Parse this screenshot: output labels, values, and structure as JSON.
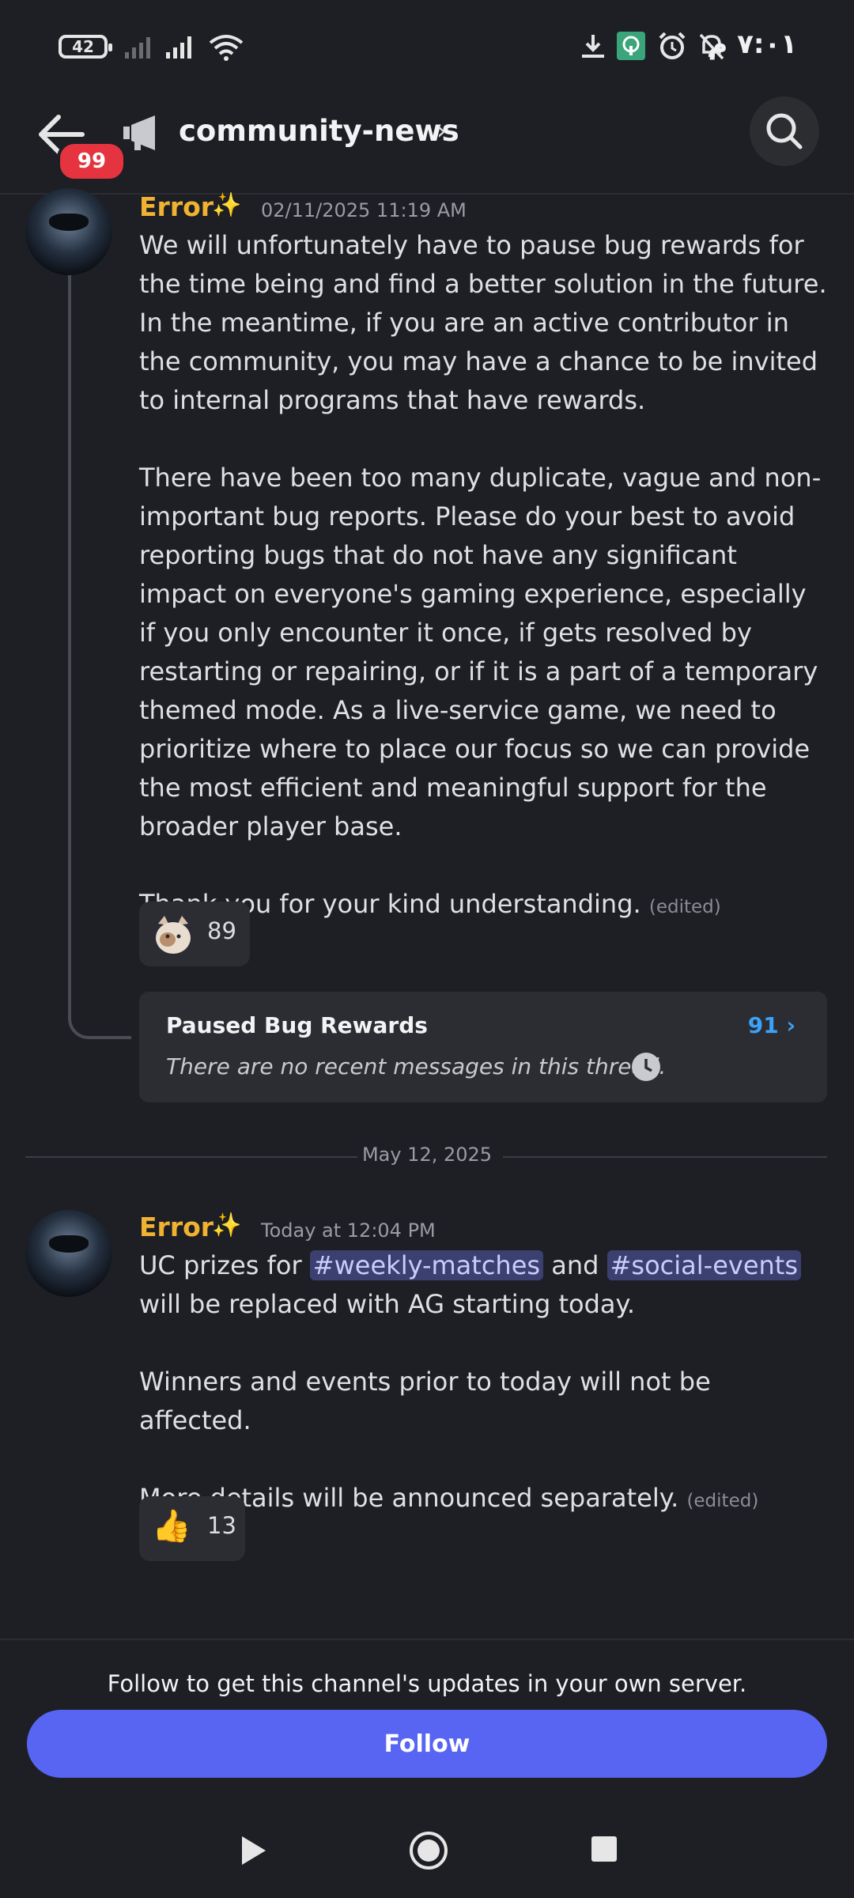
{
  "status_bar": {
    "battery": "42",
    "time": "٧:٠١ م"
  },
  "header": {
    "unread_badge": "99",
    "channel_name": "community-news",
    "chevron": "›"
  },
  "messages": [
    {
      "author": "Error",
      "timestamp": "02/11/2025 11:19 AM",
      "paragraphs": [
        "We will unfortunately have to pause bug rewards for the time being and find a better solution in the future. In the meantime, if you are an active contributor in the community, you may have a chance to be invited to internal programs that have rewards.",
        "There have been too many duplicate, vague and non-important bug reports. Please do your best to avoid reporting bugs that do not have any significant impact on everyone's gaming experience, especially if you only encounter it once, if gets resolved by restarting or repairing, or if it is a part of a temporary themed mode. As a live-service game, we need to prioritize where to place our focus so we can provide the most efficient and meaningful support for the broader player base.",
        "Thank you for your kind understanding."
      ],
      "edited": "(edited)",
      "reaction": {
        "emoji_name": "cat-emoji",
        "count": "89"
      },
      "thread": {
        "title": "Paused Bug Rewards",
        "count": "91",
        "count_chevron": "›",
        "subtitle": "There are no recent messages in this thread."
      }
    },
    {
      "author": "Error",
      "timestamp": "Today at 12:04 PM",
      "line1_prefix": "UC prizes for ",
      "mention1": "#weekly-matches",
      "line1_mid": " and ",
      "mention2": "#social-events",
      "line1_suffix": " will be replaced with AG starting today.",
      "paragraph2": "Winners and events prior to today will not be affected.",
      "paragraph3": "More details will be announced separately.",
      "edited": "(edited)",
      "reaction": {
        "emoji": "👍",
        "count": "13"
      }
    }
  ],
  "date_divider": "May 12, 2025",
  "footer": {
    "note": "Follow to get this channel's updates in your own server.",
    "follow_label": "Follow"
  },
  "colors": {
    "background": "#1e1f24",
    "author": "#f0b232",
    "accent": "#5865f2",
    "thread_count": "#3ba2f7",
    "badge": "#e5343f"
  }
}
